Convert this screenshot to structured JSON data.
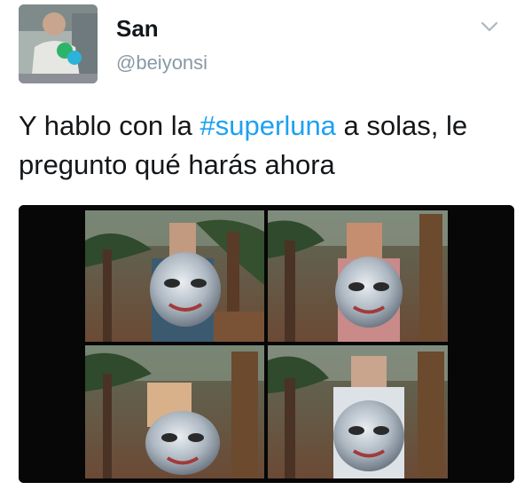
{
  "author": {
    "name": "San",
    "handle": "@beiyonsi",
    "avatar_icon": "profile-photo"
  },
  "menu": {
    "icon": "chevron-down-icon"
  },
  "tweet": {
    "text_before": "Y hablo con la ",
    "hashtag": "#superluna",
    "text_after": " a solas, le pregunto qué harás ahora"
  },
  "media": {
    "description_icon": "video-still-four-panels",
    "panels": 4
  },
  "colors": {
    "accent": "#1da1f2",
    "text": "#14171a",
    "muted": "#8899a6"
  }
}
